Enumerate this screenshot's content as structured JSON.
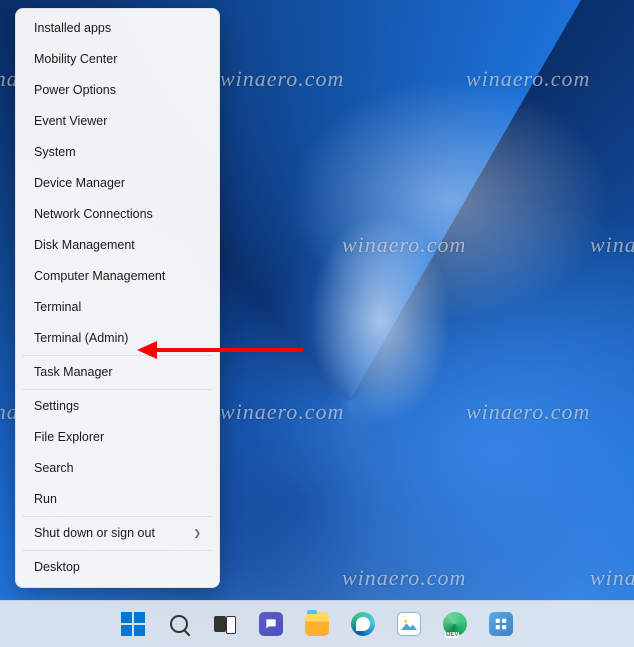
{
  "watermark": "winaero.com",
  "menu": {
    "items": [
      "Installed apps",
      "Mobility Center",
      "Power Options",
      "Event Viewer",
      "System",
      "Device Manager",
      "Network Connections",
      "Disk Management",
      "Computer Management",
      "Terminal",
      "Terminal (Admin)",
      "Task Manager",
      "Settings",
      "File Explorer",
      "Search",
      "Run",
      "Shut down or sign out",
      "Desktop"
    ]
  },
  "annotation": {
    "arrow_color": "#ff0000",
    "target_item": "Terminal (Admin)"
  },
  "taskbar": {
    "items": [
      "start",
      "search",
      "task-view",
      "chat",
      "file-explorer",
      "edge",
      "photos",
      "edge-dev",
      "settings-app"
    ]
  }
}
